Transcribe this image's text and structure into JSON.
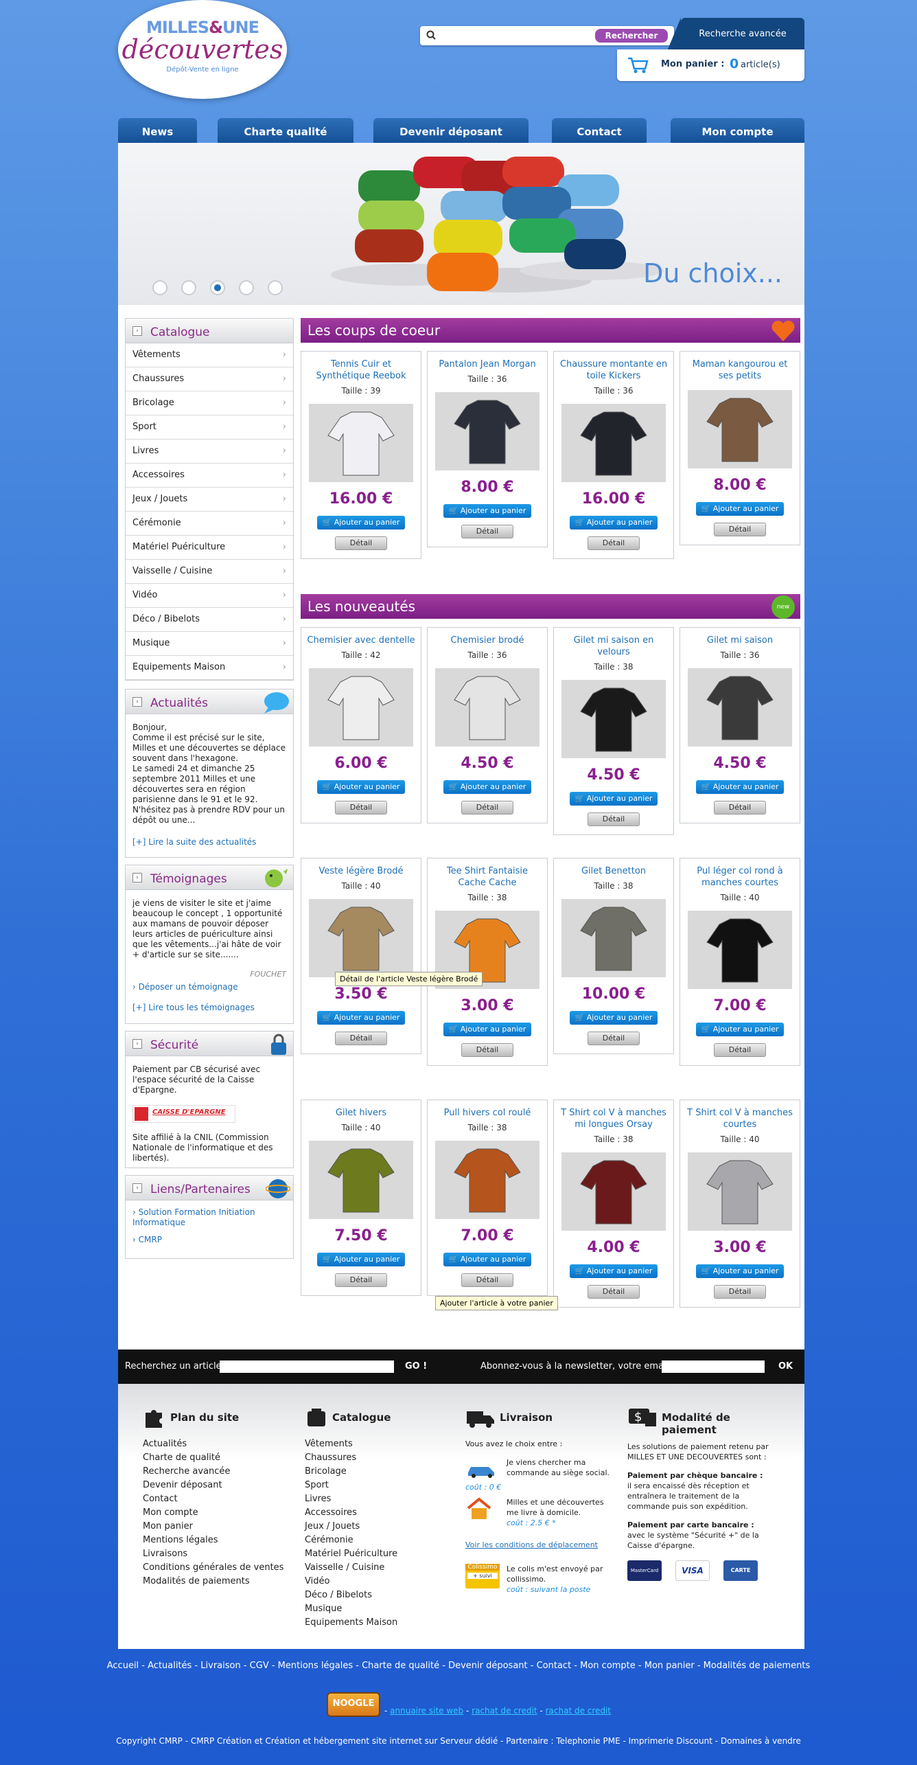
{
  "logo": {
    "line1_a": "MILLES",
    "line1_amp": "&",
    "line1_b": "UNE",
    "line2": "découvertes",
    "line3": "Dépôt-Vente en ligne"
  },
  "search": {
    "placeholder": "",
    "button": "Rechercher",
    "advanced": "Recherche avancée"
  },
  "cart": {
    "label": "Mon panier :",
    "count": "0",
    "unit": "article(s)"
  },
  "nav": [
    "News",
    "Charte qualité",
    "Devenir déposant",
    "Contact",
    "Mon compte"
  ],
  "banner": {
    "caption": "Du choix...",
    "active_dot": 3,
    "dot_count": 5
  },
  "sidebar": {
    "catalogue_title": "Catalogue",
    "categories": [
      "Vêtements",
      "Chaussures",
      "Bricolage",
      "Sport",
      "Livres",
      "Accessoires",
      "Jeux / Jouets",
      "Cérémonie",
      "Matériel Puériculture",
      "Vaisselle / Cuisine",
      "Vidéo",
      "Déco / Bibelots",
      "Musique",
      "Equipements Maison"
    ],
    "news_title": "Actualités",
    "news_text": "Bonjour,\nComme il est précisé sur le site, Milles et une découvertes se déplace souvent dans l'hexagone.\nLe samedi 24 et dimanche 25 septembre 2011 Milles et une découvertes sera en région parisienne dans le 91 et le 92. N'hésitez pas à prendre RDV pour un dépôt ou une...",
    "news_link": "[+] Lire la suite des actualités",
    "testi_title": "Témoignages",
    "testi_text": "je viens de visiter le site et j'aime beaucoup le concept , 1 opportunité aux mamans de pouvoir déposer leurs articles de puériculture ainsi que les vêtements...j'ai hâte de voir + d'article sur se site.......",
    "testi_author": "FOUCHET",
    "testi_post": "Déposer un témoignage",
    "testi_link": "[+] Lire tous les témoignages",
    "secu_title": "Sécurité",
    "secu_text": "Paiement par CB sécurisé avec l'espace sécurité de la Caisse d'Epargne.",
    "secu_logo": "CAISSE D'EPARGNE",
    "secu_text2": "Site affilié à la CNIL (Commission Nationale de l'informatique et des libertés).",
    "liens_title": "Liens/Partenaires",
    "liens": [
      "Solution Formation Initiation Informatique",
      "CMRP"
    ]
  },
  "sections": {
    "coeur": "Les coups de coeur",
    "nouveautes": "Les nouveautés",
    "new_badge": "new"
  },
  "coeur": [
    {
      "name": "Tennis Cuir et Synthétique Reebok",
      "size": "Taille : 39",
      "price": "16.00 €",
      "color": "#f0f0f4"
    },
    {
      "name": "Pantalon Jean Morgan",
      "size": "Taille : 36",
      "price": "8.00 €",
      "color": "#2a2f3a"
    },
    {
      "name": "Chaussure montante en toile Kickers",
      "size": "Taille : 36",
      "price": "16.00 €",
      "color": "#22242c"
    },
    {
      "name": "Maman kangourou et ses petits",
      "size": "",
      "price": "8.00 €",
      "color": "#7a5a40"
    }
  ],
  "nouveautes": [
    {
      "name": "Chemisier avec dentelle",
      "size": "Taille : 42",
      "price": "6.00 €",
      "color": "#eeeeee"
    },
    {
      "name": "Chemisier brodé",
      "size": "Taille : 36",
      "price": "4.50 €",
      "color": "#e4e4e4"
    },
    {
      "name": "Gilet mi saison en velours",
      "size": "Taille : 38",
      "price": "4.50 €",
      "color": "#1a1a1a"
    },
    {
      "name": "Gilet mi saison",
      "size": "Taille : 36",
      "price": "4.50 €",
      "color": "#3a3a3a"
    },
    {
      "name": "Veste légère Brodé",
      "size": "Taille : 40",
      "price": "3.50 €",
      "color": "#a58a60"
    },
    {
      "name": "Tee Shirt Fantaisie Cache Cache",
      "size": "Taille : 38",
      "price": "3.00 €",
      "color": "#e6821e"
    },
    {
      "name": "Gilet Benetton",
      "size": "Taille : 38",
      "price": "10.00 €",
      "color": "#6f6f68"
    },
    {
      "name": "Pul léger col rond à manches courtes",
      "size": "Taille : 40",
      "price": "7.00 €",
      "color": "#111111"
    },
    {
      "name": "Gilet hivers",
      "size": "Taille : 40",
      "price": "7.50 €",
      "color": "#6d7a1e"
    },
    {
      "name": "Pull hivers col roulé",
      "size": "Taille : 38",
      "price": "7.00 €",
      "color": "#b5541c"
    },
    {
      "name": "T Shirt col V à manches mi longues Orsay",
      "size": "Taille : 38",
      "price": "4.00 €",
      "color": "#6a1a1a"
    },
    {
      "name": "T Shirt col V à manches courtes",
      "size": "Taille : 40",
      "price": "3.00 €",
      "color": "#a8a8ac"
    }
  ],
  "card_labels": {
    "add": "Ajouter au panier",
    "detail": "Détail"
  },
  "tooltips": {
    "detail": "Détail de l'article Veste légère Brodé",
    "add": "Ajouter l'article à votre panier"
  },
  "bar": {
    "search_label": "Recherchez un article",
    "go": "GO !",
    "newsletter_label": "Abonnez-vous à la newsletter, votre email",
    "ok": "OK"
  },
  "footer": {
    "plan_title": "Plan du site",
    "plan": [
      "Actualités",
      "Charte de qualité",
      "Recherche avancée",
      "Devenir déposant",
      "Contact",
      "Mon compte",
      "Mon panier",
      "Mentions légales",
      "Livraisons",
      "Conditions générales de ventes",
      "Modalités de paiements"
    ],
    "cat_title": "Catalogue",
    "cat": [
      "Vêtements",
      "Chaussures",
      "Bricolage",
      "Sport",
      "Livres",
      "Accessoires",
      "Jeux / Jouets",
      "Cérémonie",
      "Matériel Puériculture",
      "Vaisselle / Cuisine",
      "Vidéo",
      "Déco / Bibelots",
      "Musique",
      "Equipements Maison"
    ],
    "liv_title": "Livraison",
    "liv_intro": "Vous avez le choix entre :",
    "liv_1": "Je viens chercher ma commande au siège social.",
    "liv_1_cost": "coût : 0 €",
    "liv_2": "Milles et une découvertes me livre à domicile.",
    "liv_2_cost": "coût : 2.5 € *",
    "liv_link": "Voir les conditions de déplacement",
    "liv_3": "Le colis m'est envoyé par collissimo.",
    "liv_3_cost": "coût : suivant la poste",
    "colissimo": "Colissimo",
    "suivi": "+ suivi",
    "pay_title": "Modalité de paiement",
    "pay_intro": "Les solutions de paiement retenu par MILLES ET UNE DECOUVERTES sont :",
    "pay_cheque_t": "Paiement par chèque bancaire :",
    "pay_cheque": "il sera encaissé dès réception et entraînera le traitement de la commande puis son expédition.",
    "pay_cb_t": "Paiement par carte bancaire :",
    "pay_cb": "avec le système \"Sécurité +\" de la Caisse d'épargne.",
    "cards": [
      "MasterCard",
      "VISA",
      "CARTE BLEUE"
    ]
  },
  "links_line": "Accueil - Actualités - Livraison - CGV - Mentions légales - Charte de qualité - Devenir déposant - Contact - Mon compte - Mon panier - Modalités de paiements",
  "noogle": {
    "logo": "NOOGLE",
    "l1": "annuaire site web",
    "l2": "rachat de credit",
    "l3": "rachat de credit"
  },
  "copyright": "Copyright CMRP - CMRP Création et Création et hébergement site internet sur Serveur dédié - Partenaire : Telephonie PME - Imprimerie Discount - Domaines à vendre"
}
